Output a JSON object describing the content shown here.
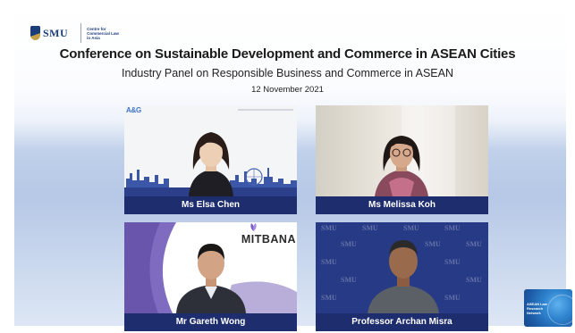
{
  "header": {
    "logo_text": "SMU",
    "centre_name": "Centre for Commercial Law in Asia",
    "title": "Conference on Sustainable Development and Commerce in ASEAN Cities",
    "subtitle": "Industry Panel on Responsible Business and Commerce in ASEAN",
    "date": "12 November 2021"
  },
  "participants": [
    {
      "name": "Ms Elsa Chen",
      "background_logo": "A&G"
    },
    {
      "name": "Ms Melissa Koh"
    },
    {
      "name": "Mr Gareth Wong",
      "background_logo": "MITBANA"
    },
    {
      "name": "Professor Archan Misra",
      "background_logo": "SMU"
    }
  ],
  "corner_badge": {
    "text": "ASEAN Law Research Network"
  },
  "colors": {
    "nameplate": "#1e2d6e",
    "brand_blue": "#1b3d7a",
    "background_blue": "#b6c8e6"
  }
}
